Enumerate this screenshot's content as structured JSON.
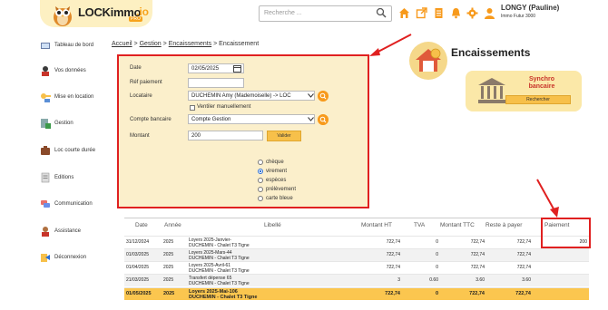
{
  "header": {
    "logo_text": "LOCKimmo",
    "logo_io": ".io",
    "logo_pro": "PRO",
    "search_placeholder": "Recherche ...",
    "user_name": "LONGY (Pauline)",
    "user_sub": "Immo Futur 3000"
  },
  "sidebar": {
    "items": [
      {
        "label": "Tableau de bord",
        "icon": "dashboard-icon"
      },
      {
        "label": "Vos données",
        "icon": "user-data-icon"
      },
      {
        "label": "Mise en location",
        "icon": "rental-key-icon"
      },
      {
        "label": "Gestion",
        "icon": "management-icon"
      },
      {
        "label": "Loc courte durée",
        "icon": "short-stay-icon"
      },
      {
        "label": "Editions",
        "icon": "editions-icon"
      },
      {
        "label": "Communication",
        "icon": "communication-icon"
      },
      {
        "label": "Assistance",
        "icon": "assistance-icon"
      },
      {
        "label": "Déconnexion",
        "icon": "logout-icon"
      }
    ]
  },
  "breadcrumb": {
    "home": "Accueil",
    "sep": ">",
    "gestion": "Gestion",
    "encaissements_link": "Encaissements",
    "current": "Encaissement"
  },
  "form": {
    "date_label": "Date",
    "date_value": "02/05/2025",
    "ref_label": "Réf paiement",
    "ref_value": "",
    "locataire_label": "Locataire",
    "locataire_value": "DUCHEMIN Amy (Mademoiselle) -> LOC",
    "ventiler_label": "Ventiler manuellement",
    "compte_label": "Compte bancaire",
    "compte_value": "Compte Gestion",
    "montant_label": "Montant",
    "montant_value": "200",
    "valider_label": "Valider",
    "payment_modes": [
      "chèque",
      "virement",
      "espèces",
      "prélèvement",
      "carte bleue"
    ],
    "payment_selected": "virement"
  },
  "panel": {
    "title": "Encaissements",
    "synchro_title_1": "Synchro",
    "synchro_title_2": "bancaire",
    "rechercher_label": "Rechercher"
  },
  "table": {
    "columns": [
      "Date",
      "Année",
      "Libellé",
      "Montant HT",
      "TVA",
      "Montant TTC",
      "Reste à payer",
      "Paiement"
    ],
    "rows": [
      {
        "date": "31/12/2024",
        "annee": "2025",
        "lib1": "Loyers 2025-Janvier-",
        "lib2": "DUCHEMIN - Chalet T3 Tigne",
        "ht": "722,74",
        "tva": "0",
        "ttc": "722,74",
        "reste": "722,74",
        "paiement": "200"
      },
      {
        "date": "01/03/2025",
        "annee": "2025",
        "lib1": "Loyers 2025-Mars-44",
        "lib2": "DUCHEMIN - Chalet T3 Tigne",
        "ht": "722,74",
        "tva": "0",
        "ttc": "722,74",
        "reste": "722,74",
        "paiement": ""
      },
      {
        "date": "01/04/2025",
        "annee": "2025",
        "lib1": "Loyers 2025-Avril-61",
        "lib2": "DUCHEMIN - Chalet T3 Tigne",
        "ht": "722,74",
        "tva": "0",
        "ttc": "722,74",
        "reste": "722,74",
        "paiement": ""
      },
      {
        "date": "21/03/2025",
        "annee": "2025",
        "lib1": "Transfert dépense 65",
        "lib2": "DUCHEMIN - Chalet T3 Tigne",
        "ht": "3",
        "tva": "0.60",
        "ttc": "3.60",
        "reste": "3.60",
        "paiement": ""
      },
      {
        "date": "01/05/2025",
        "annee": "2025",
        "lib1": "Loyers 2025-Mai-106",
        "lib2": "DUCHEMIN - Chalet T3 Tigne",
        "ht": "722,74",
        "tva": "0",
        "ttc": "722,74",
        "reste": "722,74",
        "paiement": ""
      }
    ]
  },
  "colors": {
    "accent": "#f7c04a",
    "highlight_border": "#e02020",
    "form_bg": "#fbefcb",
    "icon_orange": "#f79a1c"
  }
}
